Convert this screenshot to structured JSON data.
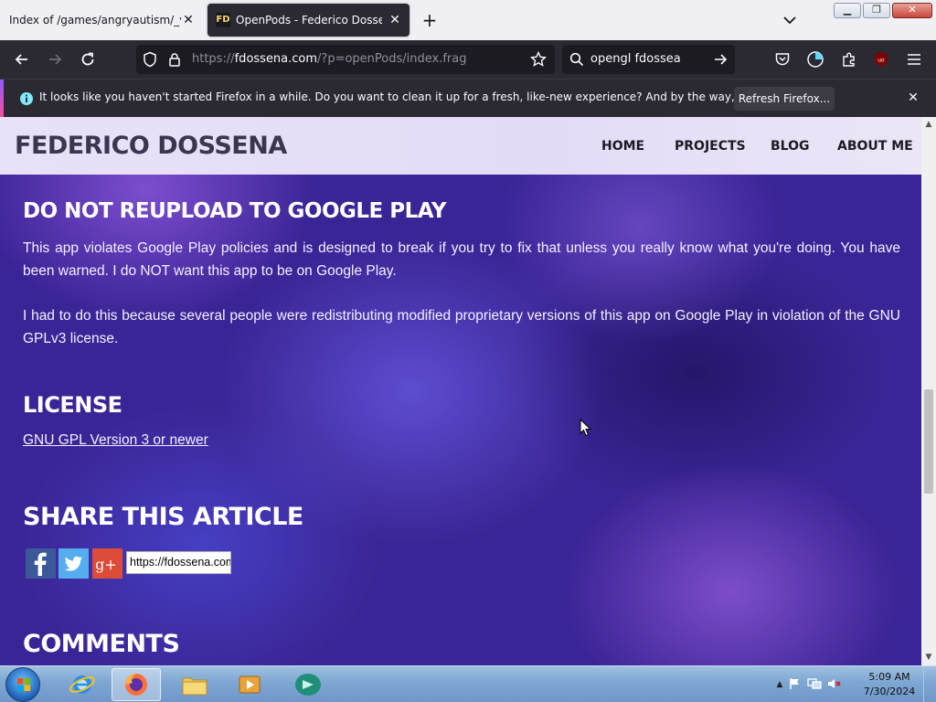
{
  "browser": {
    "tabs": [
      {
        "title": "Index of /games/angryautism/_vani",
        "active": false
      },
      {
        "title": "OpenPods - Federico Dossena",
        "favicon": "FD",
        "active": true
      }
    ],
    "url_prefix": "https://",
    "url_host": "fdossena.com",
    "url_path": "/?p=openPods/index.frag",
    "search_query": "opengl fdossea",
    "notification": {
      "text": "It looks like you haven't started Firefox in a while. Do you want to clean it up for a fresh, like-new experience? And by the way, welcome back!",
      "button_label": "Refresh Firefox..."
    }
  },
  "site": {
    "title": "FEDERICO DOSSENA",
    "nav": [
      "HOME",
      "PROJECTS",
      "BLOG",
      "ABOUT ME"
    ]
  },
  "article": {
    "warning_heading": "DO NOT REUPLOAD TO GOOGLE PLAY",
    "warning_p1": "This app violates Google Play policies and is designed to break if you try to fix that unless you really know what you're doing. You have been warned. I do NOT want this app to be on Google Play.",
    "warning_p2": "I had to do this because several people were redistributing modified proprietary versions of this app on Google Play in violation of the GNU GPLv3 license.",
    "license_heading": "LICENSE",
    "license_link": "GNU GPL Version 3 or newer",
    "share_heading": "SHARE THIS ARTICLE",
    "share_url": "https://fdossena.com/?p=openPods/index.frag",
    "comments_heading": "COMMENTS"
  },
  "taskbar": {
    "time": "5:09 AM",
    "date": "7/30/2024"
  },
  "colors": {
    "accent_purple": "#9059ff",
    "page_bg": "#3b2596",
    "facebook": "#3b5998",
    "twitter": "#55acee",
    "googleplus": "#dd4b39"
  }
}
